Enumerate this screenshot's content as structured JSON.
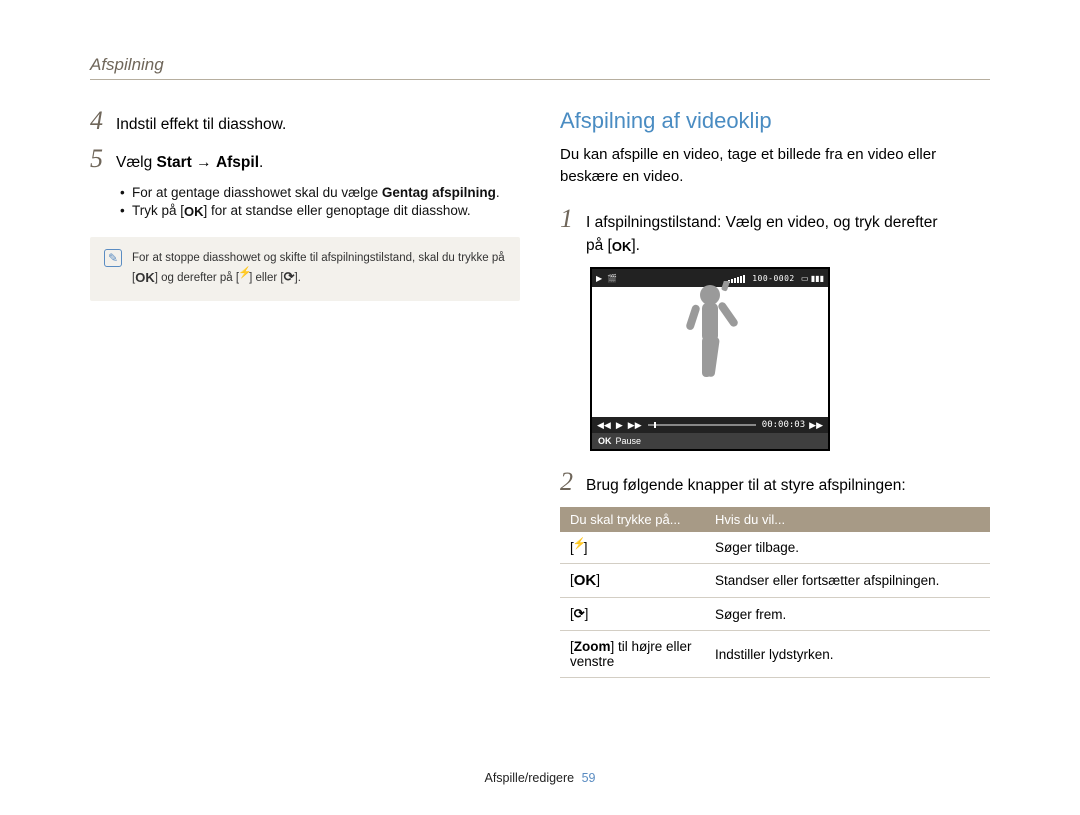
{
  "header": {
    "section": "Afspilning"
  },
  "left": {
    "step4": {
      "num": "4",
      "text": "Indstil effekt til diasshow."
    },
    "step5": {
      "num": "5",
      "prefix": "Vælg ",
      "bold1": "Start",
      "arrow": " → ",
      "bold2": "Afspil",
      "suffix": "."
    },
    "bullet1": {
      "prefix": "For at gentage diasshowet skal du vælge ",
      "bold": "Gentag afspilning",
      "suffix": "."
    },
    "bullet2": {
      "prefix": "Tryk på [",
      "ok": "OK",
      "suffix": "] for at standse eller genoptage dit diasshow."
    },
    "note": {
      "line1_a": "For at stoppe diasshowet og skifte til afspilningstilstand, skal du trykke på",
      "line2_a": "[",
      "line2_ok": "OK",
      "line2_b": "] og derefter på [",
      "line2_flash": "⚡",
      "line2_c": "] eller [",
      "line2_timer": "↻",
      "line2_d": "]."
    }
  },
  "right": {
    "title": "Afspilning af videoklip",
    "intro": "Du kan afspille en video, tage et billede fra en video eller beskære en video.",
    "step1": {
      "num": "1",
      "line1": "I afspilningstilstand: Vælg en video, og tryk derefter",
      "line2_prefix": "på [",
      "line2_ok": "OK",
      "line2_suffix": "]."
    },
    "screenshot": {
      "top_right": "100-0002",
      "timecode": "00:00:03",
      "ok_label": "OK",
      "pause": "Pause"
    },
    "step2": {
      "num": "2",
      "text": "Brug følgende knapper til at styre afspilningen:"
    },
    "table": {
      "head_press": "Du skal trykke på...",
      "head_if": "Hvis du vil...",
      "rows": [
        {
          "key_pre": "[",
          "key_glyph": "⚡",
          "key_post": "]",
          "action": "Søger tilbage."
        },
        {
          "key_pre": "[",
          "key_glyph": "OK",
          "key_post": "]",
          "action": "Standser eller fortsætter afspilningen."
        },
        {
          "key_pre": "[",
          "key_glyph": "↻",
          "key_post": "]",
          "action": "Søger frem."
        },
        {
          "zoom_pre": "[",
          "zoom_bold": "Zoom",
          "zoom_post": "] til højre eller venstre",
          "action": "Indstiller lydstyrken."
        }
      ]
    }
  },
  "footer": {
    "label": "Afspille/redigere",
    "page": "59"
  }
}
